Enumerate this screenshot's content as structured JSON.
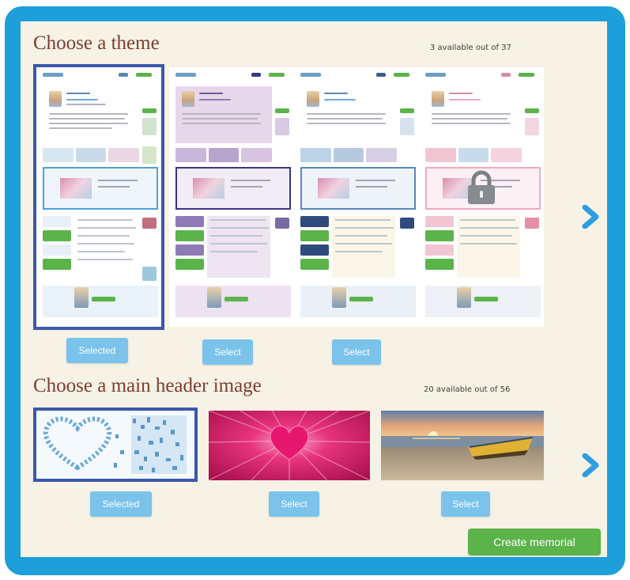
{
  "themes_section": {
    "title": "Choose a theme",
    "count": "3 available out of 37",
    "themes": [
      {
        "state": "selected",
        "button": "Selected",
        "accent": "#4f9fd8",
        "panel": "#ffffff"
      },
      {
        "state": "available",
        "button": "Select",
        "accent": "#3a3680",
        "panel": "#e7d7ea"
      },
      {
        "state": "available",
        "button": "Select",
        "accent": "#5a86b8",
        "panel": "#ffffff"
      },
      {
        "state": "locked",
        "button": "",
        "accent": "#f0a9bd",
        "panel": "#ffffff"
      }
    ]
  },
  "headers_section": {
    "title": "Choose a main header image",
    "count": "20 available out of 56",
    "images": [
      {
        "state": "selected",
        "button": "Selected",
        "subject": "blue heart pattern"
      },
      {
        "state": "available",
        "button": "Select",
        "subject": "pink heart burst"
      },
      {
        "state": "available",
        "button": "Select",
        "subject": "boat on beach at sunset"
      }
    ]
  },
  "icons": {
    "next": "chevron-right-icon",
    "lock": "lock-icon"
  },
  "colors": {
    "frame": "#1e9fd9",
    "panel": "#f6f2e6",
    "title": "#7d3d2f",
    "select_button": "#7bc3ea",
    "create_button": "#5bb34a",
    "selected_outline": "#3b58a8"
  },
  "create_button": "Create memorial"
}
